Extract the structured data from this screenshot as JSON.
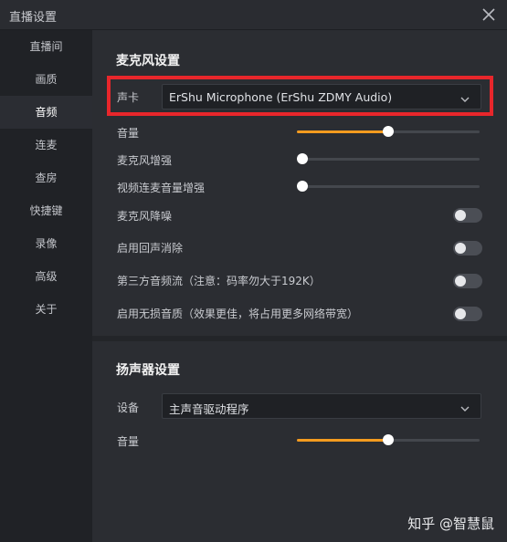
{
  "window": {
    "title": "直播设置"
  },
  "sidebar": {
    "items": [
      {
        "label": "直播间"
      },
      {
        "label": "画质"
      },
      {
        "label": "音频"
      },
      {
        "label": "连麦"
      },
      {
        "label": "查房"
      },
      {
        "label": "快捷键"
      },
      {
        "label": "录像"
      },
      {
        "label": "高级"
      },
      {
        "label": "关于"
      }
    ],
    "active": "音频"
  },
  "mic": {
    "section_title": "麦克风设置",
    "soundcard_label": "声卡",
    "soundcard_value": "ErShu Microphone (ErShu ZDMY Audio)",
    "volume_label": "音量",
    "volume_level": 0.5,
    "boost_label": "麦克风增强",
    "boost_level": 0,
    "video_boost_label": "视频连麦音量增强",
    "video_boost_level": 0,
    "noise_label": "麦克风降噪",
    "noise_on": false,
    "echo_label": "启用回声消除",
    "echo_on": false,
    "thirdparty_label": "第三方音频流（注意：码率勿大于192K）",
    "thirdparty_on": false,
    "lossless_label": "启用无损音质（效果更佳，将占用更多网络带宽）",
    "lossless_on": false
  },
  "speaker": {
    "section_title": "扬声器设置",
    "device_label": "设备",
    "device_value": "主声音驱动程序",
    "volume_label": "音量",
    "volume_level": 0.5
  },
  "watermark": "知乎 @智慧鼠",
  "colors": {
    "accent": "#f49b1f",
    "highlight": "#e8262b"
  }
}
